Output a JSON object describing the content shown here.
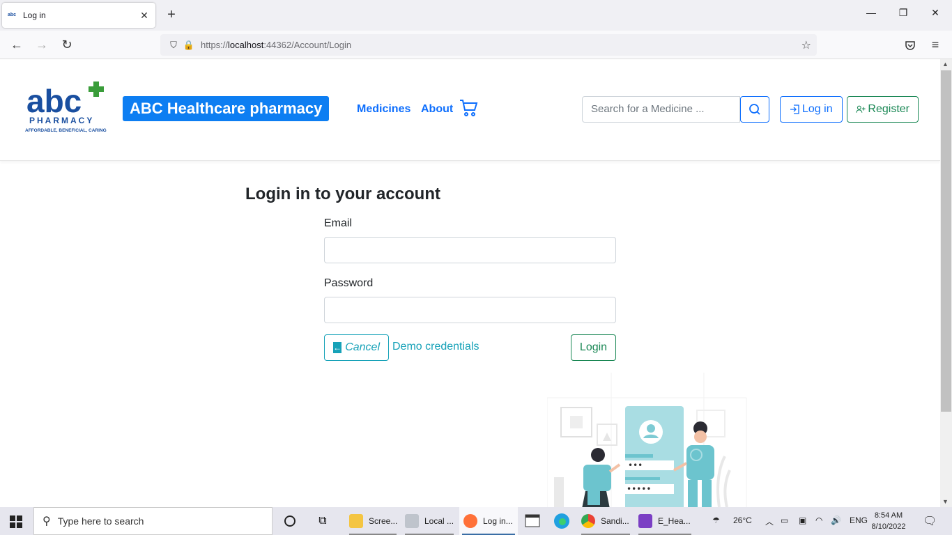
{
  "browser": {
    "tab_title": "Log in",
    "tab_favicon_text": "abc",
    "url_prefix": "https://",
    "url_host": "localhost",
    "url_rest": ":44362/Account/Login"
  },
  "header": {
    "logo_text": "abc",
    "logo_subtitle": "PHARMACY",
    "logo_tagline": "AFFORDABLE, BENEFICIAL, CARING",
    "brand": "ABC Healthcare pharmacy",
    "nav": [
      "Medicines",
      "About"
    ],
    "search_placeholder": "Search for a Medicine ...",
    "login_label": "Log in",
    "register_label": "Register",
    "brand_color": "#0d7ef2"
  },
  "login": {
    "heading": "Login in to your account",
    "email_label": "Email",
    "email_value": "",
    "password_label": "Password",
    "password_value": "",
    "cancel_label": "Cancel",
    "demo_label": "Demo credentials",
    "submit_label": "Login",
    "illustration_dots_1": "•••",
    "illustration_dots_2": "•••••"
  },
  "taskbar": {
    "search_placeholder": "Type here to search",
    "apps": [
      "Scree...",
      "Local ...",
      "Log in...",
      "Sandi...",
      "E_Hea..."
    ],
    "temperature": "26°C",
    "language": "ENG",
    "time": "8:54 AM",
    "date": "8/10/2022"
  }
}
